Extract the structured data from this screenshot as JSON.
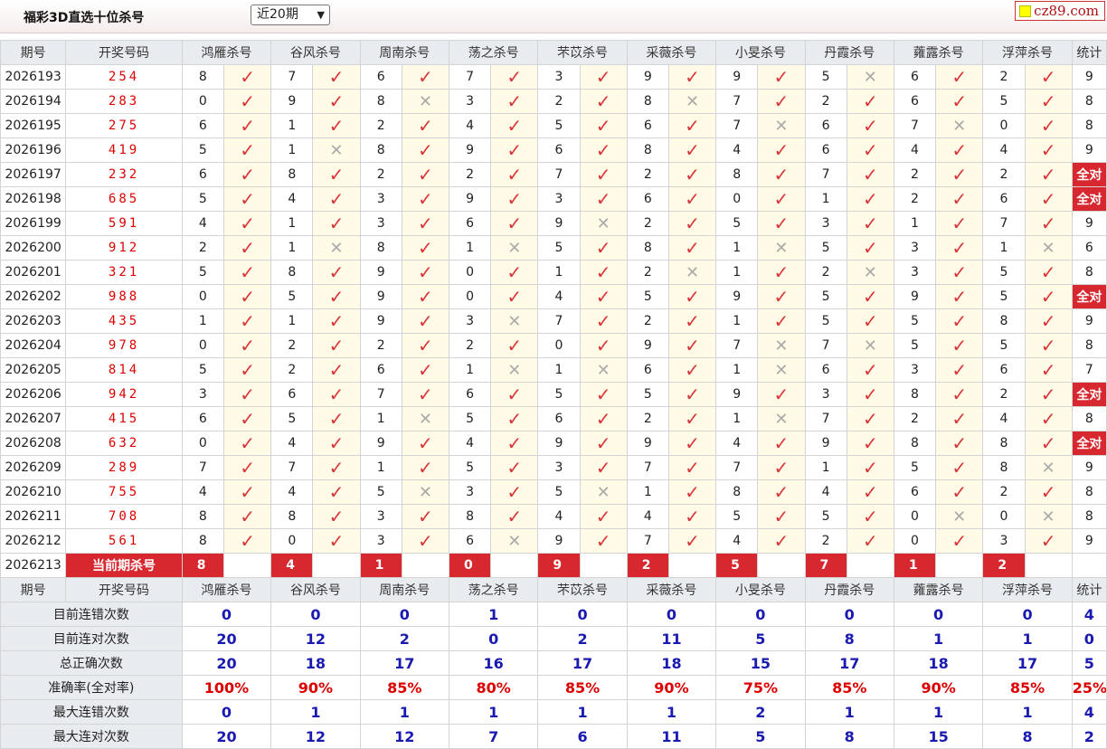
{
  "header": {
    "title": "福彩3D直选十位杀号",
    "period_select": "近20期",
    "site_logo": "cz89.com"
  },
  "columns": {
    "issue": "期号",
    "code": "开奖号码",
    "experts": [
      "鸿雁杀号",
      "谷风杀号",
      "周南杀号",
      "荡之杀号",
      "芣苡杀号",
      "采薇杀号",
      "小旻杀号",
      "丹霞杀号",
      "蕹露杀号",
      "浮萍杀号"
    ],
    "stat": "统计"
  },
  "marks": {
    "hit": "✓",
    "miss": "✕"
  },
  "rows": [
    {
      "issue": "2026193",
      "code": "254",
      "picks": [
        8,
        7,
        6,
        7,
        3,
        9,
        9,
        5,
        6,
        2
      ],
      "hits": [
        1,
        1,
        1,
        1,
        1,
        1,
        1,
        0,
        1,
        1
      ],
      "stat": "9"
    },
    {
      "issue": "2026194",
      "code": "283",
      "picks": [
        0,
        9,
        8,
        3,
        2,
        8,
        7,
        2,
        6,
        5
      ],
      "hits": [
        1,
        1,
        0,
        1,
        1,
        0,
        1,
        1,
        1,
        1
      ],
      "stat": "8"
    },
    {
      "issue": "2026195",
      "code": "275",
      "picks": [
        6,
        1,
        2,
        4,
        5,
        6,
        7,
        6,
        7,
        0
      ],
      "hits": [
        1,
        1,
        1,
        1,
        1,
        1,
        0,
        1,
        0,
        1
      ],
      "stat": "8"
    },
    {
      "issue": "2026196",
      "code": "419",
      "picks": [
        5,
        1,
        8,
        9,
        6,
        8,
        4,
        6,
        4,
        4
      ],
      "hits": [
        1,
        0,
        1,
        1,
        1,
        1,
        1,
        1,
        1,
        1
      ],
      "stat": "9"
    },
    {
      "issue": "2026197",
      "code": "232",
      "picks": [
        6,
        8,
        2,
        2,
        7,
        2,
        8,
        7,
        2,
        2
      ],
      "hits": [
        1,
        1,
        1,
        1,
        1,
        1,
        1,
        1,
        1,
        1
      ],
      "stat": "全对"
    },
    {
      "issue": "2026198",
      "code": "685",
      "picks": [
        5,
        4,
        3,
        9,
        3,
        6,
        0,
        1,
        2,
        6
      ],
      "hits": [
        1,
        1,
        1,
        1,
        1,
        1,
        1,
        1,
        1,
        1
      ],
      "stat": "全对"
    },
    {
      "issue": "2026199",
      "code": "591",
      "picks": [
        4,
        1,
        3,
        6,
        9,
        2,
        5,
        3,
        1,
        7
      ],
      "hits": [
        1,
        1,
        1,
        1,
        0,
        1,
        1,
        1,
        1,
        1
      ],
      "stat": "9"
    },
    {
      "issue": "2026200",
      "code": "912",
      "picks": [
        2,
        1,
        8,
        1,
        5,
        8,
        1,
        5,
        3,
        1
      ],
      "hits": [
        1,
        0,
        1,
        0,
        1,
        1,
        0,
        1,
        1,
        0
      ],
      "stat": "6"
    },
    {
      "issue": "2026201",
      "code": "321",
      "picks": [
        5,
        8,
        9,
        0,
        1,
        2,
        1,
        2,
        3,
        5
      ],
      "hits": [
        1,
        1,
        1,
        1,
        1,
        0,
        1,
        0,
        1,
        1
      ],
      "stat": "8"
    },
    {
      "issue": "2026202",
      "code": "988",
      "picks": [
        0,
        5,
        9,
        0,
        4,
        5,
        9,
        5,
        9,
        5
      ],
      "hits": [
        1,
        1,
        1,
        1,
        1,
        1,
        1,
        1,
        1,
        1
      ],
      "stat": "全对"
    },
    {
      "issue": "2026203",
      "code": "435",
      "picks": [
        1,
        1,
        9,
        3,
        7,
        2,
        1,
        5,
        5,
        8
      ],
      "hits": [
        1,
        1,
        1,
        0,
        1,
        1,
        1,
        1,
        1,
        1
      ],
      "stat": "9"
    },
    {
      "issue": "2026204",
      "code": "978",
      "picks": [
        0,
        2,
        2,
        2,
        0,
        9,
        7,
        7,
        5,
        5
      ],
      "hits": [
        1,
        1,
        1,
        1,
        1,
        1,
        0,
        0,
        1,
        1
      ],
      "stat": "8"
    },
    {
      "issue": "2026205",
      "code": "814",
      "picks": [
        5,
        2,
        6,
        1,
        1,
        6,
        1,
        6,
        3,
        6
      ],
      "hits": [
        1,
        1,
        1,
        0,
        0,
        1,
        0,
        1,
        1,
        1
      ],
      "stat": "7"
    },
    {
      "issue": "2026206",
      "code": "942",
      "picks": [
        3,
        6,
        7,
        6,
        5,
        5,
        9,
        3,
        8,
        2
      ],
      "hits": [
        1,
        1,
        1,
        1,
        1,
        1,
        1,
        1,
        1,
        1
      ],
      "stat": "全对"
    },
    {
      "issue": "2026207",
      "code": "415",
      "picks": [
        6,
        5,
        1,
        5,
        6,
        2,
        1,
        7,
        2,
        4
      ],
      "hits": [
        1,
        1,
        0,
        1,
        1,
        1,
        0,
        1,
        1,
        1
      ],
      "stat": "8"
    },
    {
      "issue": "2026208",
      "code": "632",
      "picks": [
        0,
        4,
        9,
        4,
        9,
        9,
        4,
        9,
        8,
        8
      ],
      "hits": [
        1,
        1,
        1,
        1,
        1,
        1,
        1,
        1,
        1,
        1
      ],
      "stat": "全对"
    },
    {
      "issue": "2026209",
      "code": "289",
      "picks": [
        7,
        7,
        1,
        5,
        3,
        7,
        7,
        1,
        5,
        8
      ],
      "hits": [
        1,
        1,
        1,
        1,
        1,
        1,
        1,
        1,
        1,
        0
      ],
      "stat": "9"
    },
    {
      "issue": "2026210",
      "code": "755",
      "picks": [
        4,
        4,
        5,
        3,
        5,
        1,
        8,
        4,
        6,
        2
      ],
      "hits": [
        1,
        1,
        0,
        1,
        0,
        1,
        1,
        1,
        1,
        1
      ],
      "stat": "8"
    },
    {
      "issue": "2026211",
      "code": "708",
      "picks": [
        8,
        8,
        3,
        8,
        4,
        4,
        5,
        5,
        0,
        0
      ],
      "hits": [
        1,
        1,
        1,
        1,
        1,
        1,
        1,
        1,
        0,
        0
      ],
      "stat": "8"
    },
    {
      "issue": "2026212",
      "code": "561",
      "picks": [
        8,
        0,
        3,
        6,
        9,
        7,
        4,
        2,
        0,
        3
      ],
      "hits": [
        1,
        1,
        1,
        0,
        1,
        1,
        1,
        1,
        1,
        1
      ],
      "stat": "9"
    }
  ],
  "current": {
    "issue": "2026213",
    "label": "当前期杀号",
    "picks": [
      "8",
      "4",
      "1",
      "0",
      "9",
      "2",
      "5",
      "7",
      "1",
      "2"
    ]
  },
  "stats": [
    {
      "label": "目前连错次数",
      "values": [
        "0",
        "0",
        "0",
        "1",
        "0",
        "0",
        "0",
        "0",
        "0",
        "0"
      ],
      "total": "4"
    },
    {
      "label": "目前连对次数",
      "values": [
        "20",
        "12",
        "2",
        "0",
        "2",
        "11",
        "5",
        "8",
        "1",
        "1"
      ],
      "total": "0"
    },
    {
      "label": "总正确次数",
      "values": [
        "20",
        "18",
        "17",
        "16",
        "17",
        "18",
        "15",
        "17",
        "18",
        "17"
      ],
      "total": "5"
    },
    {
      "label": "准确率(全对率)",
      "values": [
        "100%",
        "90%",
        "85%",
        "80%",
        "85%",
        "90%",
        "75%",
        "85%",
        "90%",
        "85%"
      ],
      "total": "25%",
      "rate": true
    },
    {
      "label": "最大连错次数",
      "values": [
        "0",
        "1",
        "1",
        "1",
        "1",
        "1",
        "2",
        "1",
        "1",
        "1"
      ],
      "total": "4"
    },
    {
      "label": "最大连对次数",
      "values": [
        "20",
        "12",
        "12",
        "7",
        "6",
        "11",
        "5",
        "8",
        "15",
        "8"
      ],
      "total": "2"
    }
  ]
}
